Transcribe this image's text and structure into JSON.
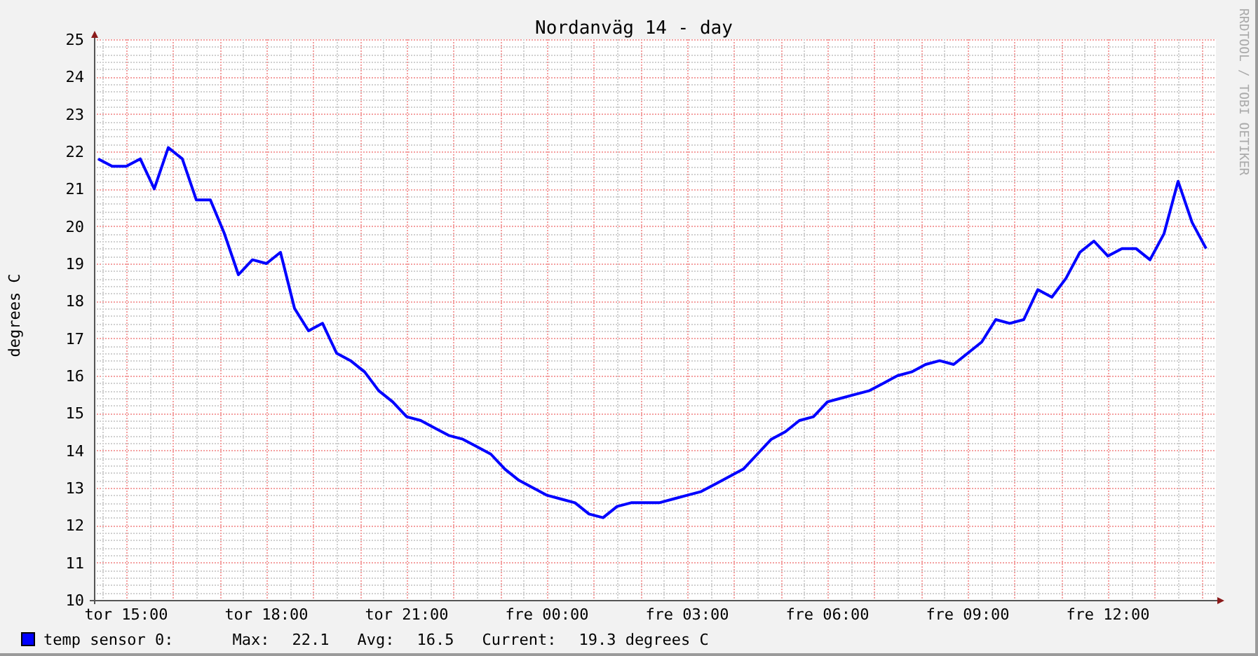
{
  "watermark": "RRDTOOL / TOBI OETIKER",
  "chart_data": {
    "type": "line",
    "title": "Nordanväg 14 - day",
    "ylabel": "degrees C",
    "categories": [
      null,
      null,
      "tor 15:00",
      null,
      null,
      null,
      null,
      null,
      null,
      null,
      null,
      null,
      "tor 18:00",
      null,
      null,
      null,
      null,
      null,
      null,
      null,
      null,
      null,
      "tor 21:00",
      null,
      null,
      null,
      null,
      null,
      null,
      null,
      null,
      null,
      "fre 00:00",
      null,
      null,
      null,
      null,
      null,
      null,
      null,
      null,
      null,
      "fre 03:00",
      null,
      null,
      null,
      null,
      null,
      null,
      null,
      null,
      null,
      "fre 06:00",
      null,
      null,
      null,
      null,
      null,
      null,
      null,
      null,
      null,
      "fre 09:00",
      null,
      null,
      null,
      null,
      null,
      null,
      null,
      null,
      null,
      "fre 12:00",
      null,
      null,
      null,
      null,
      null,
      null,
      null
    ],
    "series": [
      {
        "name": "temp sensor 0:",
        "color": "#0000ff",
        "values": [
          21.8,
          21.6,
          21.6,
          21.8,
          21.0,
          22.1,
          21.8,
          20.7,
          20.7,
          19.8,
          18.7,
          19.1,
          19.0,
          19.3,
          17.8,
          17.2,
          17.4,
          16.6,
          16.4,
          16.1,
          15.6,
          15.3,
          14.9,
          14.8,
          14.6,
          14.4,
          14.3,
          14.1,
          13.9,
          13.5,
          13.2,
          13.0,
          12.8,
          12.7,
          12.6,
          12.3,
          12.2,
          12.5,
          12.6,
          12.6,
          12.6,
          12.7,
          12.8,
          12.9,
          13.1,
          13.3,
          13.5,
          13.9,
          14.3,
          14.5,
          14.8,
          14.9,
          15.3,
          15.4,
          15.5,
          15.6,
          15.8,
          16.0,
          16.1,
          16.3,
          16.4,
          16.3,
          16.6,
          16.9,
          17.5,
          17.4,
          17.5,
          18.3,
          18.1,
          18.6,
          19.3,
          19.6,
          19.2,
          19.4,
          19.4,
          19.1,
          19.8,
          21.2,
          20.1,
          19.4
        ]
      }
    ],
    "grid": true,
    "ylim": [
      10,
      25
    ],
    "yticks": [
      10,
      11,
      12,
      13,
      14,
      15,
      16,
      17,
      18,
      19,
      20,
      21,
      22,
      23,
      24,
      25
    ]
  },
  "legend": [
    {
      "stats": [
        {
          "label": "Max:",
          "value": "22.1"
        },
        {
          "label": "Avg:",
          "value": "16.5"
        },
        {
          "label": "Current:",
          "value": "19.3 degrees C"
        }
      ]
    }
  ]
}
